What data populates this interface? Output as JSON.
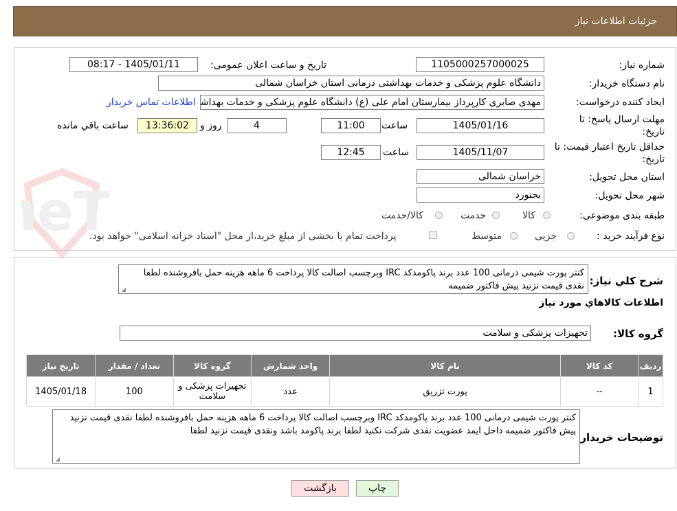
{
  "header": {
    "title": "جزئیات اطلاعات نیاز"
  },
  "fields": {
    "need_number_label": "شماره نیاز:",
    "need_number": "1105000257000025",
    "announce_label": "تاریخ و ساعت اعلان عمومی:",
    "announce_value": "1405/01/11 - 08:17",
    "buyer_org_label": "نام دستگاه خریدار:",
    "buyer_org": "دانشگاه علوم پزشکی و خدمات بهداشتی درمانی استان خراسان شمالی",
    "creator_label": "ایجاد کننده درخواست:",
    "creator": "مهدی صابری کارپرداز بیمارستان امام علی (ع) دانشگاه علوم پزشکی و خدمات بهداشتی",
    "contact_link": "اطلاعات تماس خریدار",
    "deadline_label_1": "مهلت ارسال پاسخ: تا",
    "deadline_label_2": "تاریخ:",
    "deadline_date": "1405/01/16",
    "time_label": "ساعت",
    "deadline_time": "11:00",
    "days_value": "4",
    "days_label": "روز و",
    "remaining_time": "13:36:02",
    "remaining_label": "ساعت باقي مانده",
    "validity_label_1": "حداقل تاریخ اعتبار قیمت: تا",
    "validity_label_2": "تاریخ:",
    "validity_date": "1405/11/07",
    "validity_time_label": "ساعت",
    "validity_time": "12:45",
    "province_label": "استان محل تحویل:",
    "province": "خراسان شمالی",
    "city_label": "شهر محل تحویل:",
    "city": "بجنورد",
    "category_label": "طبقه بندی موضوعی:",
    "category_options": [
      "کالا",
      "خدمت",
      "کالا/خدمت"
    ],
    "process_label": "نوع فرآیند خرید :",
    "process_options": [
      "جزیی",
      "متوسط"
    ],
    "payment_note": "پرداخت تمام یا بخشی از مبلغ خرید،از محل \"اسناد خزانه اسلامی\" خواهد بود."
  },
  "summary": {
    "label": "شرح کلي نياز:",
    "text": "کنتر پورت شیمی درمانی 100 عدد برند پاکومدکد IRC وبرچسب اصالت کالا پرداخت 6 ماهه هزینه حمل بافروشنده لطفا نقدی قیمت نزنید  پیش فاکتور ضمیمه"
  },
  "goods_info_title": "اطلاعات کالاهاي مورد نياز",
  "goods_group": {
    "label": "گروه کالا:",
    "value": "تجهیزات پزشکی و سلامت"
  },
  "table": {
    "headers": [
      "رديف",
      "کد کالا",
      "نام کالا",
      "واحد شمارش",
      "گروه کالا",
      "تعداد / مقدار",
      "تاریخ نیاز"
    ],
    "rows": [
      [
        "1",
        "--",
        "پورت تزریق",
        "عدد",
        "تجهیزات پزشکی و سلامت",
        "100",
        "1405/01/18"
      ]
    ]
  },
  "buyer_notes": {
    "label": "توضیحات خریدار:",
    "text": "کنتر پورت شیمی درمانی 100 عدد برند پاکومدکد IRC وبرچسب اصالت کالا پرداخت 6 ماهه هزینه حمل بافروشنده لطفا نقدی قیمت نزنید  پیش فاکتور ضمیمه داخل ایمد عضویت نقدی شرکت نکنید لطفا برند پاکومد باشد ونقدی قیمت نزنید لطفا"
  },
  "buttons": {
    "print": "چاپ",
    "back": "بازگشت"
  },
  "watermark": "AriaTender.neT",
  "colors": {
    "header_bg": "#8c6d49",
    "table_header_bg": "#7c7c7c",
    "remaining_bg": "#ffffcc",
    "back_btn_bg": "#ffe0e0",
    "print_btn_bg": "#e4f7dc",
    "link": "#1a3fd0"
  }
}
